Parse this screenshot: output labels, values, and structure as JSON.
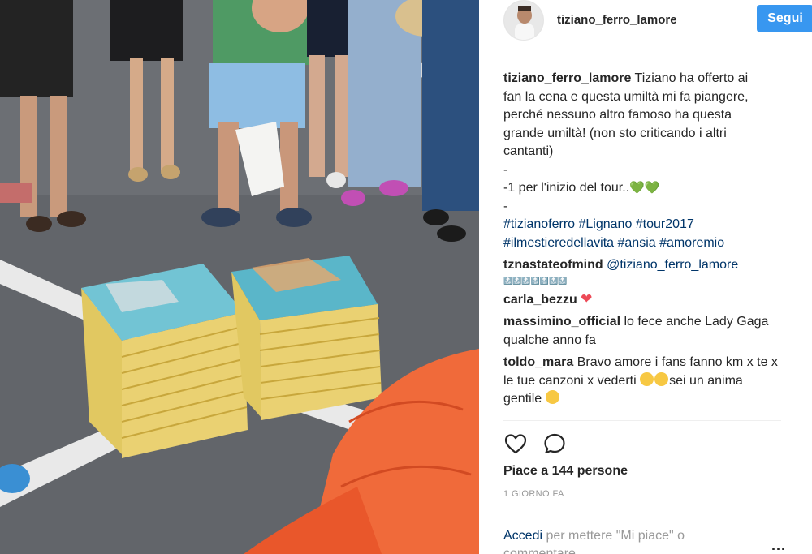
{
  "post": {
    "username": "tiziano_ferro_lamore",
    "follow_label": "Segui",
    "caption_user": "tiziano_ferro_lamore",
    "caption_lines": [
      "Tiziano ha offerto ai",
      "fan la cena e questa umiltà mi fa piangere,",
      "perché nessuno altro famoso ha questa",
      "grande umiltà! (non sto criticando i altri",
      "cantanti)",
      "-",
      "-1 per l'inizio del tour..",
      "-"
    ],
    "hashtags_line1": "#tizianoferro #Lignano #tour2017",
    "hashtags_line2": "#ilmestieredellavita #ansia #amoremio",
    "comments": [
      {
        "user": "tznastateofmind",
        "text": "@tiziano_ferro_lamore",
        "extra": "🔝🔝🔝🔝🔝🔝🔝"
      },
      {
        "user": "carla_bezzu",
        "text": ""
      },
      {
        "user": "massimino_official",
        "text": "lo fece anche Lady Gaga qualche anno fa"
      },
      {
        "user": "toldo_mara",
        "text": "Bravo amore i fans fanno km x te x le tue canzoni x vederti",
        "text2": "sei un anima gentile"
      }
    ],
    "likes": "Piace a 144 persone",
    "time_ago": "1 GIORNO FA",
    "login_link": "Accedi",
    "login_rest": "per mettere \"Mi piace\" o commentare.",
    "more": "..."
  },
  "icons": {
    "like": "heart-outline-icon",
    "comment": "comment-bubble-icon",
    "more": "more-options-icon"
  },
  "colors": {
    "follow_button": "#3897f0",
    "link": "#003569",
    "muted": "#999999",
    "text": "#262626"
  }
}
